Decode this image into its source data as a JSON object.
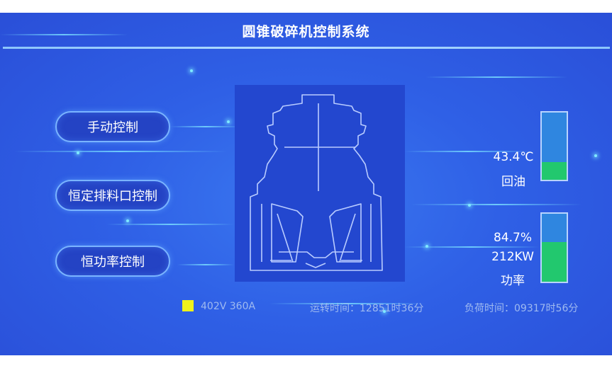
{
  "header": {
    "title": "圆锥破碎机控制系统"
  },
  "controls": {
    "manual": "手动控制",
    "fixed_outlet": "恒定排料口控制",
    "constant_power": "恒功率控制"
  },
  "machine": {
    "icon": "cone-crusher-icon"
  },
  "oil_gauge": {
    "temperature": "43.4℃",
    "label": "回油",
    "level_fraction": 0.26
  },
  "power_gauge": {
    "percent": "84.7%",
    "power": "212KW",
    "label": "功率",
    "level_fraction": 0.58
  },
  "status_bar": {
    "indicator_color": "#eef21a",
    "electrical": "402V 360A",
    "run_time": "运转时间：12851时36分",
    "load_time": "负荷时间：09317时56分"
  },
  "colors": {
    "background": "#2f60e6",
    "gauge_fill": "#22c86e",
    "gauge_empty": "#2f86e0"
  }
}
